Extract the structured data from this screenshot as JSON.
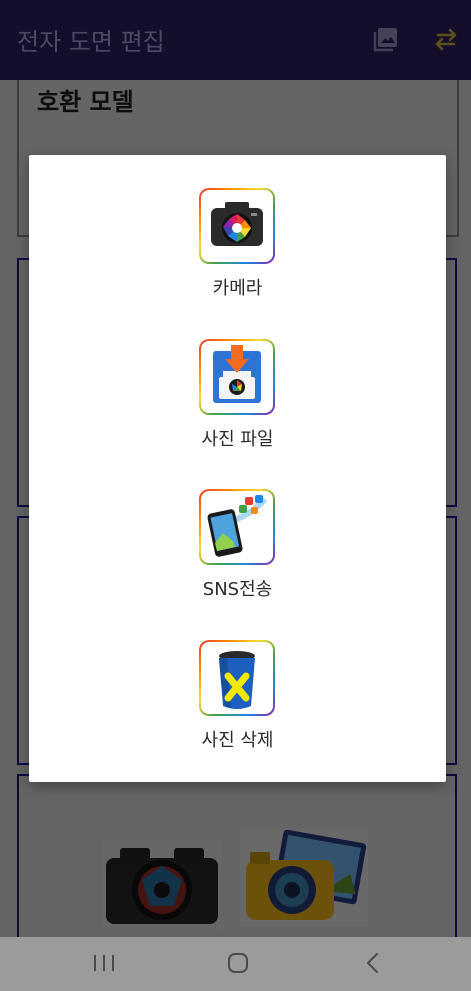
{
  "appbar": {
    "title": "전자 도면 편집",
    "icons": [
      "gallery-icon",
      "swap-icon"
    ],
    "background": "#201444",
    "accent": "#8d7a2a"
  },
  "background_content": {
    "section_title": "호환 모델"
  },
  "dialog": {
    "options": [
      {
        "label": "카메라",
        "icon": "camera-icon"
      },
      {
        "label": "사진 파일",
        "icon": "save-photo-icon"
      },
      {
        "label": "SNS전송",
        "icon": "sns-share-icon"
      },
      {
        "label": "사진 삭제",
        "icon": "trash-icon"
      }
    ]
  },
  "navbar": {
    "icons": [
      "recents-icon",
      "home-icon",
      "back-icon"
    ]
  }
}
